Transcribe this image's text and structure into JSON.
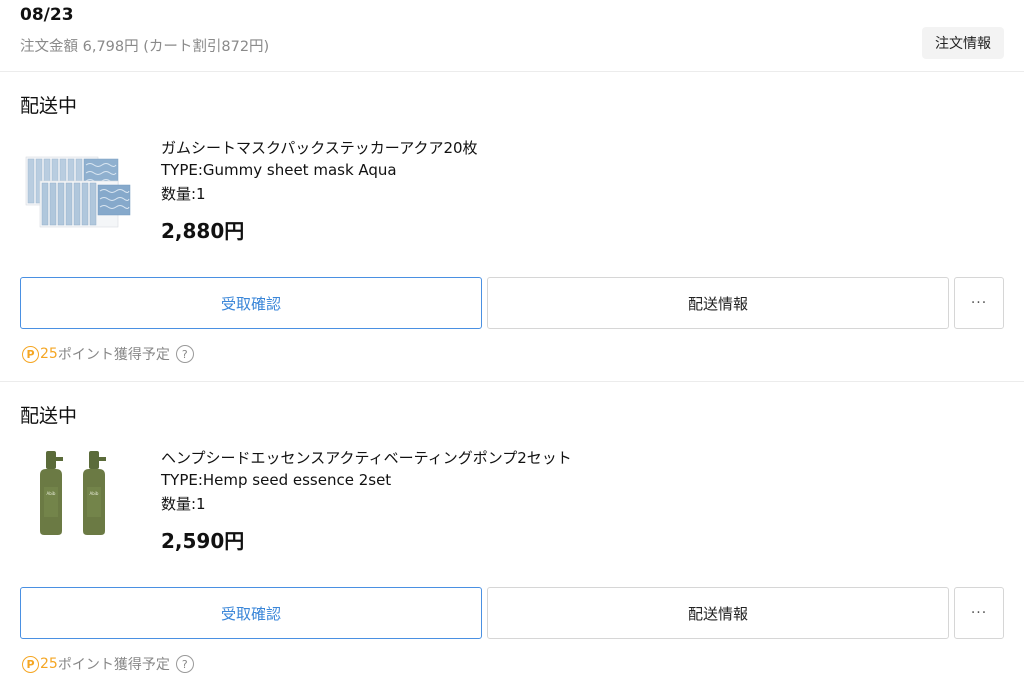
{
  "order": {
    "date": "08/23",
    "amount_text": "注文金額 6,798円 (カート割引872円)",
    "info_button": "注文情報"
  },
  "shipments": [
    {
      "status": "配送中",
      "product": {
        "name": "ガムシートマスクパックステッカーアクア20枚",
        "type": "TYPE:Gummy sheet mask Aqua",
        "quantity": "数量:1",
        "price": "2,880円",
        "image_icon": "sheet-mask-pack-image"
      },
      "buttons": {
        "receive": "受取確認",
        "ship_info": "配送情報",
        "more": "···"
      },
      "points": {
        "icon": "Ⓟ",
        "amount": "25",
        "label": "ポイント獲得予定",
        "help": "?"
      }
    },
    {
      "status": "配送中",
      "product": {
        "name": "ヘンプシードエッセンスアクティベーティングポンプ2セット",
        "type": "TYPE:Hemp seed essence 2set",
        "quantity": "数量:1",
        "price": "2,590円",
        "image_icon": "hemp-essence-bottles-image"
      },
      "buttons": {
        "receive": "受取確認",
        "ship_info": "配送情報",
        "more": "···"
      },
      "points": {
        "icon": "Ⓟ",
        "amount": "25",
        "label": "ポイント獲得予定",
        "help": "?"
      }
    }
  ],
  "colors": {
    "accent_blue": "#3a86d8",
    "point_orange": "#f5a623",
    "muted_text": "#8a8a8a"
  }
}
